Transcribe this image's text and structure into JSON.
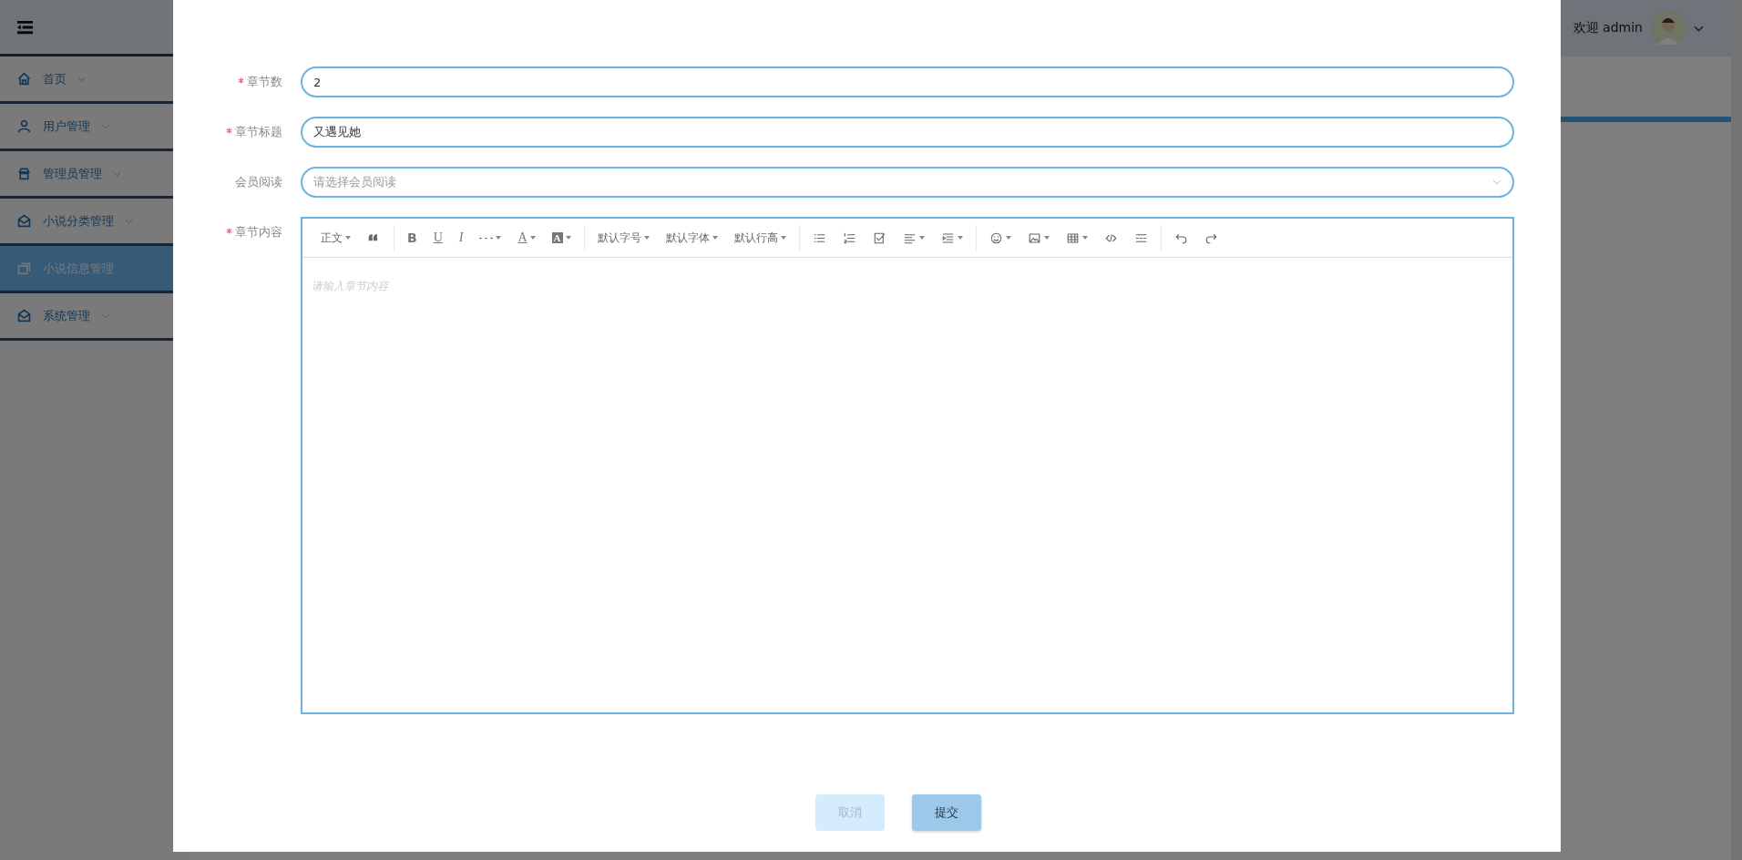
{
  "header": {
    "greeting": "欢迎 admin"
  },
  "sidebar": {
    "items": [
      {
        "label": "首页",
        "selected": false
      },
      {
        "label": "用户管理",
        "selected": false
      },
      {
        "label": "管理员管理",
        "selected": false
      },
      {
        "label": "小说分类管理",
        "selected": false
      },
      {
        "label": "小说信息管理",
        "selected": true
      },
      {
        "label": "系统管理",
        "selected": false
      }
    ]
  },
  "form": {
    "fields": [
      {
        "kind": "input",
        "label": "章节数",
        "required": true,
        "value": "2"
      },
      {
        "kind": "input",
        "label": "章节标题",
        "required": true,
        "value": "又遇见她"
      },
      {
        "kind": "select",
        "label": "会员阅读",
        "required": false,
        "placeholder": "请选择会员阅读"
      },
      {
        "kind": "editor",
        "label": "章节内容",
        "required": true,
        "placeholder": "请输入章节内容"
      }
    ],
    "toolbar": [
      [
        {
          "kind": "text",
          "label": "正文",
          "dropdown": true
        },
        {
          "kind": "quote",
          "dropdown": false
        }
      ],
      [
        {
          "kind": "bold",
          "label": "B",
          "dropdown": false
        },
        {
          "kind": "underline",
          "label": "U",
          "dropdown": false
        },
        {
          "kind": "italic",
          "label": "I",
          "dropdown": false
        },
        {
          "kind": "more",
          "dropdown": true
        },
        {
          "kind": "color",
          "label": "A",
          "dropdown": true
        },
        {
          "kind": "bgcolor",
          "label": "A",
          "dropdown": true
        }
      ],
      [
        {
          "kind": "text",
          "label": "默认字号",
          "dropdown": true
        },
        {
          "kind": "text",
          "label": "默认字体",
          "dropdown": true
        },
        {
          "kind": "text",
          "label": "默认行高",
          "dropdown": true
        }
      ],
      [
        {
          "kind": "bullets",
          "dropdown": false
        },
        {
          "kind": "numbers",
          "dropdown": false
        },
        {
          "kind": "todo",
          "dropdown": false
        },
        {
          "kind": "align",
          "dropdown": true
        },
        {
          "kind": "indent",
          "dropdown": true
        }
      ],
      [
        {
          "kind": "emoji",
          "dropdown": true
        },
        {
          "kind": "image",
          "dropdown": true
        },
        {
          "kind": "table",
          "dropdown": true
        },
        {
          "kind": "code",
          "dropdown": false
        },
        {
          "kind": "divider",
          "dropdown": false
        }
      ],
      [
        {
          "kind": "undo",
          "dropdown": false
        },
        {
          "kind": "redo",
          "dropdown": false
        }
      ]
    ],
    "buttons": [
      {
        "label": "取消",
        "kind": "cancel"
      },
      {
        "label": "提交",
        "kind": "submit"
      }
    ]
  }
}
